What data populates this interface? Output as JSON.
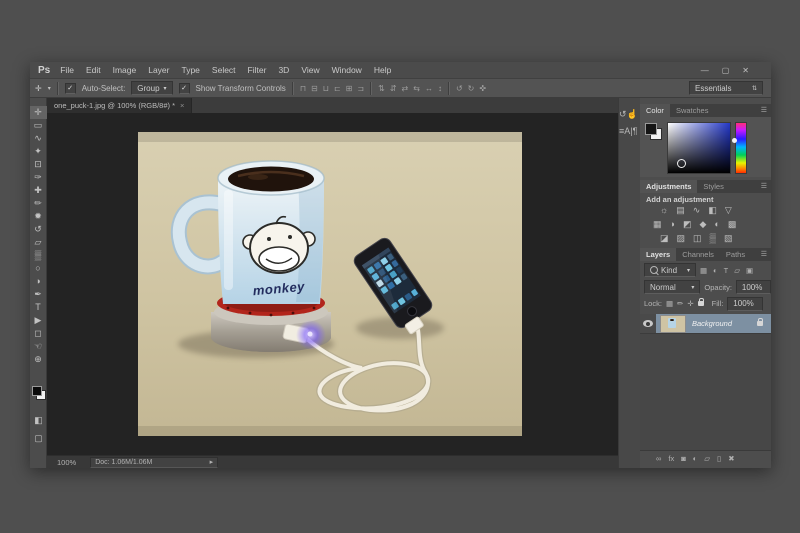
{
  "window_controls": {
    "minimize": "—",
    "restore": "▢",
    "close": "✕"
  },
  "menu_bar": {
    "logo": "Ps",
    "items": [
      {
        "name": "menu-file",
        "label": "File"
      },
      {
        "name": "menu-edit",
        "label": "Edit"
      },
      {
        "name": "menu-image",
        "label": "Image"
      },
      {
        "name": "menu-layer",
        "label": "Layer"
      },
      {
        "name": "menu-type",
        "label": "Type"
      },
      {
        "name": "menu-select",
        "label": "Select"
      },
      {
        "name": "menu-filter",
        "label": "Filter"
      },
      {
        "name": "menu-3d",
        "label": "3D"
      },
      {
        "name": "menu-view",
        "label": "View"
      },
      {
        "name": "menu-window",
        "label": "Window"
      },
      {
        "name": "menu-help",
        "label": "Help"
      }
    ]
  },
  "options_bar": {
    "tool_glyph": "✛",
    "tool_arrow": "▾",
    "auto_select_check": "✓",
    "auto_select_label": "Auto-Select:",
    "group_value": "Group",
    "group_arrow": "▾",
    "transform_check": "✓",
    "transform_label": "Show Transform Controls",
    "align_icons": [
      {
        "name": "align-top-edges-icon",
        "glyph": "⊓"
      },
      {
        "name": "align-vertical-centers-icon",
        "glyph": "⊟"
      },
      {
        "name": "align-bottom-edges-icon",
        "glyph": "⊔"
      },
      {
        "name": "align-left-edges-icon",
        "glyph": "⊏"
      },
      {
        "name": "align-horizontal-centers-icon",
        "glyph": "⊞"
      },
      {
        "name": "align-right-edges-icon",
        "glyph": "⊐"
      }
    ],
    "distribute_icons": [
      {
        "name": "distribute-top-edges-icon",
        "glyph": "⇅"
      },
      {
        "name": "distribute-vertical-centers-icon",
        "glyph": "⇵"
      },
      {
        "name": "distribute-bottom-edges-icon",
        "glyph": "⇄"
      },
      {
        "name": "distribute-left-edges-icon",
        "glyph": "⇆"
      },
      {
        "name": "distribute-horizontal-centers-icon",
        "glyph": "↔"
      },
      {
        "name": "distribute-right-edges-icon",
        "glyph": "↕"
      }
    ],
    "extra_icons": [
      {
        "name": "auto-align-layers-icon",
        "glyph": "↺"
      },
      {
        "name": "rotate-view-icon",
        "glyph": "↻"
      },
      {
        "name": "arrange-documents-icon",
        "glyph": "✜"
      }
    ],
    "workspace_value": "Essentials",
    "workspace_arrow": "⇅"
  },
  "document_tab": {
    "title": "one_puck-1.jpg @ 100% (RGB/8#) *",
    "close": "×"
  },
  "toolbar": {
    "tools": [
      {
        "name": "move-tool",
        "glyph": "✛",
        "active": true
      },
      {
        "name": "rectangular-marquee-tool",
        "glyph": "▭"
      },
      {
        "name": "lasso-tool",
        "glyph": "∿"
      },
      {
        "name": "quick-selection-tool",
        "glyph": "✦"
      },
      {
        "name": "crop-tool",
        "glyph": "⊡"
      },
      {
        "name": "eyedropper-tool",
        "glyph": "✑"
      },
      {
        "name": "spot-healing-brush-tool",
        "glyph": "✚"
      },
      {
        "name": "brush-tool",
        "glyph": "✏"
      },
      {
        "name": "clone-stamp-tool",
        "glyph": "✹"
      },
      {
        "name": "history-brush-tool",
        "glyph": "↺"
      },
      {
        "name": "eraser-tool",
        "glyph": "▱"
      },
      {
        "name": "gradient-tool",
        "glyph": "▒"
      },
      {
        "name": "blur-tool",
        "glyph": "○"
      },
      {
        "name": "dodge-tool",
        "glyph": "◑"
      },
      {
        "name": "pen-tool",
        "glyph": "✒"
      },
      {
        "name": "type-tool",
        "glyph": "T"
      },
      {
        "name": "path-selection-tool",
        "glyph": "▶"
      },
      {
        "name": "rectangle-tool",
        "glyph": "◻"
      },
      {
        "name": "hand-tool",
        "glyph": "☜"
      },
      {
        "name": "zoom-tool",
        "glyph": "⊕"
      }
    ],
    "fg_color": "#0a0a0a",
    "bg_color": "#f2f2f2",
    "mask_mode_glyph": "◧",
    "screen_mode_glyph": "▢"
  },
  "status_bar": {
    "zoom": "100%",
    "doc_info": "Doc: 1.06M/1.06M",
    "arrow": "▸"
  },
  "icon_dock": {
    "icons": [
      {
        "name": "history-panel-icon",
        "glyph": "↺"
      },
      {
        "name": "properties-panel-icon",
        "glyph": "☝"
      },
      {
        "name": "info-panel-icon",
        "glyph": "≡"
      },
      {
        "name": "character-panel-icon",
        "glyph": "A|"
      },
      {
        "name": "paragraph-panel-icon",
        "glyph": "¶"
      }
    ]
  },
  "panels": {
    "color": {
      "tab_color": "Color",
      "tab_swatches": "Swatches",
      "menu_icon": "☰",
      "hue": "#2438c8"
    },
    "adjustments": {
      "tab_adjustments": "Adjustments",
      "tab_styles": "Styles",
      "menu_icon": "☰",
      "add_label": "Add an adjustment",
      "row1": [
        {
          "name": "brightness-contrast-icon",
          "glyph": "☼"
        },
        {
          "name": "levels-icon",
          "glyph": "▤"
        },
        {
          "name": "curves-icon",
          "glyph": "∿"
        },
        {
          "name": "exposure-icon",
          "glyph": "◧"
        },
        {
          "name": "vibrance-icon",
          "glyph": "▽"
        }
      ],
      "row2": [
        {
          "name": "hue-saturation-icon",
          "glyph": "▦"
        },
        {
          "name": "color-balance-icon",
          "glyph": "◑"
        },
        {
          "name": "black-white-icon",
          "glyph": "◩"
        },
        {
          "name": "photo-filter-icon",
          "glyph": "◆"
        },
        {
          "name": "channel-mixer-icon",
          "glyph": "◐"
        },
        {
          "name": "color-lookup-icon",
          "glyph": "▩"
        }
      ],
      "row3": [
        {
          "name": "invert-icon",
          "glyph": "◪"
        },
        {
          "name": "posterize-icon",
          "glyph": "▨"
        },
        {
          "name": "threshold-icon",
          "glyph": "◫"
        },
        {
          "name": "gradient-map-icon",
          "glyph": "▒"
        },
        {
          "name": "selective-color-icon",
          "glyph": "▧"
        }
      ]
    },
    "layers": {
      "tab_layers": "Layers",
      "tab_channels": "Channels",
      "tab_paths": "Paths",
      "menu_icon": "☰",
      "kind_label": "Kind",
      "kind_arrow": "▾",
      "filter_icons": [
        {
          "name": "pixel-layer-filter-icon",
          "glyph": "▦"
        },
        {
          "name": "adjustment-layer-filter-icon",
          "glyph": "◐"
        },
        {
          "name": "type-layer-filter-icon",
          "glyph": "T"
        },
        {
          "name": "shape-layer-filter-icon",
          "glyph": "▱"
        },
        {
          "name": "smart-object-filter-icon",
          "glyph": "▣"
        }
      ],
      "blend_mode": "Normal",
      "blend_arrow": "▾",
      "opacity_label": "Opacity:",
      "opacity_value": "100%",
      "lock_label": "Lock:",
      "lock_icons": [
        {
          "name": "lock-transparency-icon",
          "glyph": "▦"
        },
        {
          "name": "lock-image-icon",
          "glyph": "✏"
        },
        {
          "name": "lock-position-icon",
          "glyph": "✛"
        }
      ],
      "fill_label": "Fill:",
      "fill_value": "100%",
      "layer_name": "Background",
      "bottom_icons": [
        {
          "name": "link-layers-icon",
          "glyph": "∞"
        },
        {
          "name": "layer-styles-icon",
          "glyph": "fx"
        },
        {
          "name": "add-layer-mask-icon",
          "glyph": "◙"
        },
        {
          "name": "new-adjustment-layer-icon",
          "glyph": "◐"
        },
        {
          "name": "new-group-icon",
          "glyph": "▱"
        },
        {
          "name": "new-layer-icon",
          "glyph": "▯"
        },
        {
          "name": "delete-layer-icon",
          "glyph": "✖"
        }
      ]
    }
  },
  "canvas": {
    "mug_text": "monkey"
  }
}
